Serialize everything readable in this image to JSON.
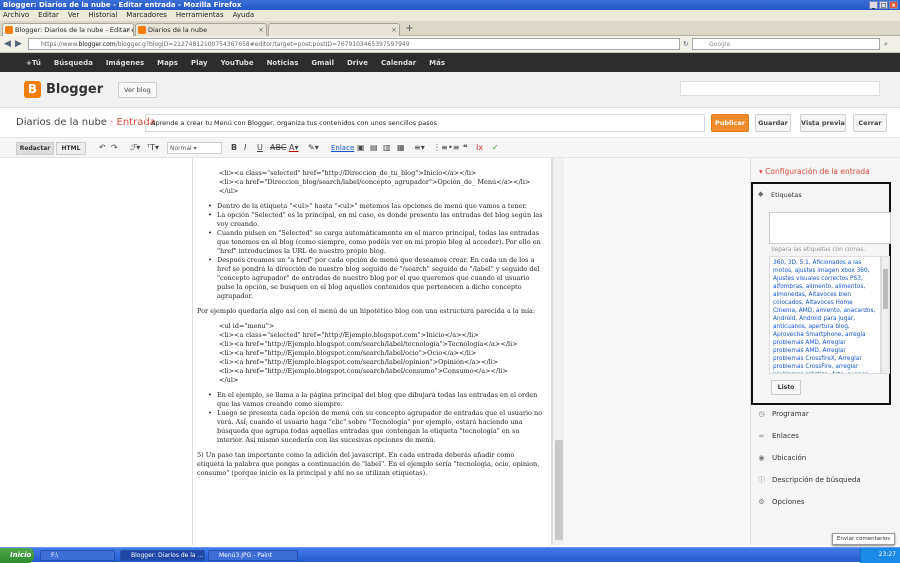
{
  "window": {
    "title": "Blogger: Diarios de la nube - Editar entrada - Mozilla Firefox"
  },
  "menu": [
    "Archivo",
    "Editar",
    "Ver",
    "Historial",
    "Marcadores",
    "Herramientas",
    "Ayuda"
  ],
  "tabs": [
    {
      "label": "Blogger: Diarios de la nube - Editar entrada"
    },
    {
      "label": "Diarios de la nube"
    },
    {
      "label": ""
    }
  ],
  "url": {
    "prefix": "https://www.",
    "domain": "blogger.com",
    "rest": "/blogger.g?blogID=21274812100754367658#editor/target=post;postID=7679103465397597949"
  },
  "search": {
    "placeholder": "Google"
  },
  "google_bar": [
    "+Tú",
    "Búsqueda",
    "Imágenes",
    "Maps",
    "Play",
    "YouTube",
    "Noticias",
    "Gmail",
    "Drive",
    "Calendar",
    "Más"
  ],
  "header": {
    "app": "Blogger",
    "view_blog": "Ver blog"
  },
  "editor": {
    "blog_name": "Diarios de la nube",
    "separator": "·",
    "section": "Entrada",
    "post_title": "Aprende a crear tu Menú con Blogger, organiza tus contenidos con unos sencillos pasos",
    "publish": "Publicar",
    "save": "Guardar",
    "preview": "Vista previa",
    "close": "Cerrar"
  },
  "toolbar": {
    "compose": "Redactar",
    "html": "HTML",
    "font_size": "Normal",
    "link": "Enlace"
  },
  "content": {
    "code1": [
      "<li><a class=\"selected\" href=\"http://Direccion_de_tu_blog\">Inicio</a></li>",
      "<li><a href=\"Direccion_blog/search/label/concepto_agrupador\">Opción_de_ Menú</a></li>",
      "</ul>"
    ],
    "bullets1": [
      "Dentro de la etiqueta \"<ul>\" hasta \"<ul>\" metemos las opciones de menú que vamos a tener.",
      "La opción \"Selected\" es la principal, en mi caso, es donde presento las entradas del blog según las voy creando.",
      "Cuando pulsen en \"Selected\" se carga automáticamente en el marco principal, todas las entradas que tenemos en el blog (como siempre, como podéis ver en mi propio blog al acceder). Por ello en \"href\" introducimos la URL de nuestro propio blog.",
      "Después creamos un \"a href\" por cada opción de menú que deseamos crear. En cada un de los a href se pondrá la dirección de nuestro blog seguido de \"/search\" seguido de \"/label\" y seguido del \"concepto agrupador\" de entradas de nuestro blog por el que queremos que cuando el usuario pulse la opción, se busquen en el blog aquellos contenidos que pertenecen a dicho concepto agrupador."
    ],
    "para1": "Por ejemplo quedaría algo así con el menú de un hipotético blog con una estructura parecida a la mía:",
    "code2": [
      "<ul id=\"menu\">",
      "<li><a class=\"selected\" href=\"http://Ejemplo.blogspot.com\">Inicio</a></li>",
      "<li><a href=\"http://Ejemplo.blogspot.com/search/label/tecnologia\">Tecnología</a></li>",
      "<li><a href=\"http://Ejemplo.blogspot.com/search/label/ocio\">Ocio</a></li>",
      "<li><a href=\"http://Ejemplo.blogspot.com/search/label/opinion\">Opinión</a></li>",
      "<li><a href=\"http://Ejemplo.blogspot.com/search/label/consumo\">Consumo</a></li>",
      "</ul>"
    ],
    "bullets2": [
      "En el ejemplo, se llama a la página principal del blog que dibujará todas las entradas en el orden que las vamos creando como siempre.",
      "Luego se presenta cada opción de menú con su concepto agrupador de entradas que el usuario no verá. Así, cuando el usuario haga \"clic\" sobre \"Tecnología\" por ejemplo, estará haciendo una búsqueda que agrupa todas aquellas entradas que contengan la etiqueta \"tecnología\" en su interior. Así mismo sucedería con las sucesivas opciones de menú."
    ],
    "para2": "5) Un paso tan importante como la adición del javascript. En cada entrada deberás añadir como etiqueta la palabra que pongas a continuación de \"label\". En el ejemplo sería \"tecnologia, ocio, opinion, consumo\" (porque inicio es la principal y ahí no se utilizan etiquetas)."
  },
  "sidebar": {
    "title": "Configuración de la entrada",
    "labels_title": "Etiquetas",
    "labels_hint": "Separa las etiquetas con comas.",
    "labels_list": "360, 3D, 5.1, Aficionados a las motos, ajustes imagen xbox 360, Ajustes visuales correctos PS3, alfombras, alimento, alimentos, almonedas, Altavoces bien colocados, Altavoces Home Cinema, AMD, amiento, anacardos, Android, Android para jugar, anticuanos, apertura blog, Aprovecha Smartphone, arregla problemas AMD, Arreglar problemas AMD, Arreglar problemas CrossfireX, Arreglar problemas CrossFire, arreglar problemas plástico, Arte, avance Playstation 4, ayuda con vídeo",
    "done": "Listo",
    "items": [
      "Programar",
      "Enlaces",
      "Ubicación",
      "Descripción de búsqueda",
      "Opciones"
    ]
  },
  "feedback": "Enviar comentarios",
  "taskbar": {
    "start": "Inicio",
    "items": [
      "F:\\",
      "Blogger: Diarios de la ...",
      "Menú3.JPG - Paint"
    ],
    "clock": "23:27"
  }
}
